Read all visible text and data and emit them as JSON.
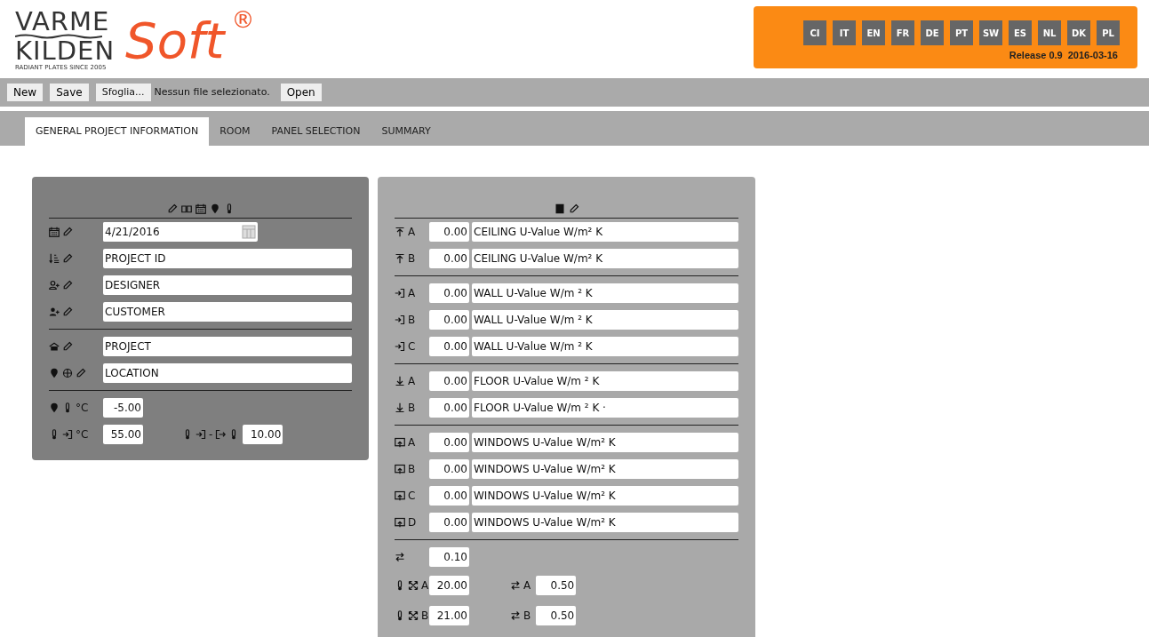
{
  "logo": {
    "line1": "VARME",
    "line2": "KILDEN",
    "tagline": "RADIANT PLATES SINCE 2005",
    "soft": "Soft",
    "mark": "®"
  },
  "languages": [
    "CI",
    "IT",
    "EN",
    "FR",
    "DE",
    "PT",
    "SW",
    "ES",
    "NL",
    "DK",
    "PL"
  ],
  "release": "Release 0.9",
  "release_date": "2016-03-16",
  "toolbar": {
    "new": "New",
    "save": "Save",
    "browse": "Sfoglia...",
    "file_status": "Nessun file selezionato.",
    "open": "Open"
  },
  "tabs": [
    {
      "label": "GENERAL PROJECT INFORMATION",
      "selected": true
    },
    {
      "label": "ROOM",
      "selected": false
    },
    {
      "label": "PANEL SELECTION",
      "selected": false
    },
    {
      "label": "SUMMARY",
      "selected": false
    }
  ],
  "project_panel": {
    "groups": [
      [
        {
          "kind": "date",
          "value": "4/21/2016"
        },
        {
          "kind": "id",
          "value": "PROJECT ID"
        },
        {
          "kind": "designer",
          "value": "DESIGNER"
        },
        {
          "kind": "customer",
          "value": "CUSTOMER"
        }
      ],
      [
        {
          "kind": "project",
          "value": "PROJECT"
        },
        {
          "kind": "location",
          "value": "LOCATION"
        }
      ]
    ],
    "outdoor_unit": "°C",
    "outdoor_temp": "-5.00",
    "supply_unit": "°C",
    "supply_temp": "55.00",
    "delta_sep": "-",
    "delta": "10.00"
  },
  "room_panel": {
    "groups": [
      {
        "kind": "ceiling",
        "rows": [
          {
            "letter": "A",
            "value": "0.00",
            "label": "CEILING U-Value W/m² K"
          },
          {
            "letter": "B",
            "value": "0.00",
            "label": "CEILING U-Value W/m² K"
          }
        ]
      },
      {
        "kind": "wall",
        "rows": [
          {
            "letter": "A",
            "value": "0.00",
            "label": "WALL U-Value W/m ² K"
          },
          {
            "letter": "B",
            "value": "0.00",
            "label": "WALL U-Value W/m ² K"
          },
          {
            "letter": "C",
            "value": "0.00",
            "label": "WALL U-Value W/m ² K"
          }
        ]
      },
      {
        "kind": "floor",
        "rows": [
          {
            "letter": "A",
            "value": "0.00",
            "label": "FLOOR U-Value W/m ² K"
          },
          {
            "letter": "B",
            "value": "0.00",
            "label": "FLOOR U-Value W/m ² K ·"
          }
        ]
      },
      {
        "kind": "window",
        "rows": [
          {
            "letter": "A",
            "value": "0.00",
            "label": "WINDOWS U-Value W/m² K"
          },
          {
            "letter": "B",
            "value": "0.00",
            "label": "WINDOWS U-Value W/m² K"
          },
          {
            "letter": "C",
            "value": "0.00",
            "label": "WINDOWS U-Value W/m² K"
          },
          {
            "letter": "D",
            "value": "0.00",
            "label": "WINDOWS U-Value W/m² K"
          }
        ]
      }
    ],
    "exchange": "0.10",
    "zones": [
      {
        "letter": "A",
        "temp": "20.00",
        "rate_letter": "A",
        "rate": "0.50"
      },
      {
        "letter": "B",
        "temp": "21.00",
        "rate_letter": "B",
        "rate": "0.50"
      }
    ]
  }
}
